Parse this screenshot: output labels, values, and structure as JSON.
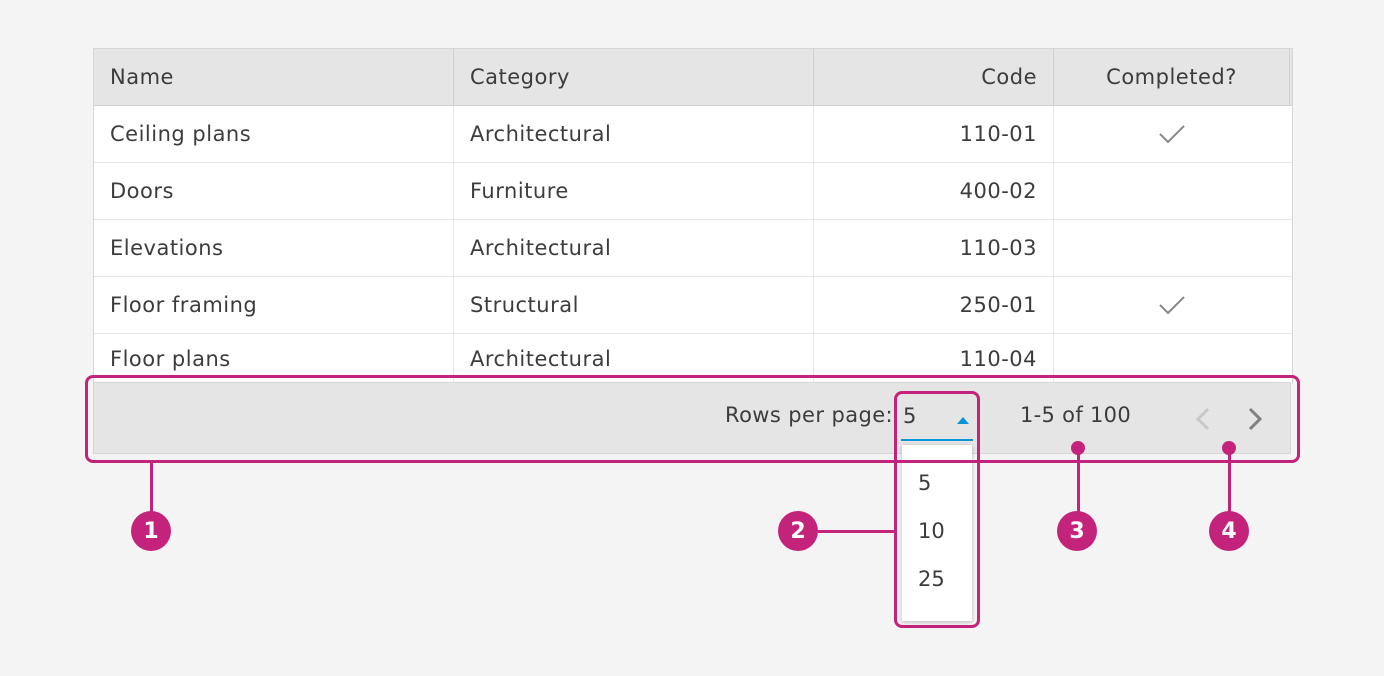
{
  "table": {
    "columns": [
      "Name",
      "Category",
      "Code",
      "Completed?"
    ],
    "rows": [
      {
        "name": "Ceiling plans",
        "category": "Architectural",
        "code": "110-01",
        "completed": true
      },
      {
        "name": "Doors",
        "category": "Furniture",
        "code": "400-02",
        "completed": false
      },
      {
        "name": "Elevations",
        "category": "Architectural",
        "code": "110-03",
        "completed": false
      },
      {
        "name": "Floor framing",
        "category": "Structural",
        "code": "250-01",
        "completed": true
      },
      {
        "name": "Floor plans",
        "category": "Architectural",
        "code": "110-04",
        "completed": false
      }
    ]
  },
  "pagination": {
    "rows_per_page_label": "Rows per page:",
    "rows_per_page_value": "5",
    "options": [
      "5",
      "10",
      "25"
    ],
    "range_text": "1-5 of 100",
    "prev_icon": "chevron-left-icon",
    "next_icon": "chevron-right-icon"
  },
  "annotations": {
    "markers": [
      "1",
      "2",
      "3",
      "4"
    ]
  },
  "colors": {
    "accent": "#0696d7",
    "annotation": "#c4237b",
    "header_bg": "#e5e5e5",
    "page_bg": "#f4f4f4"
  }
}
